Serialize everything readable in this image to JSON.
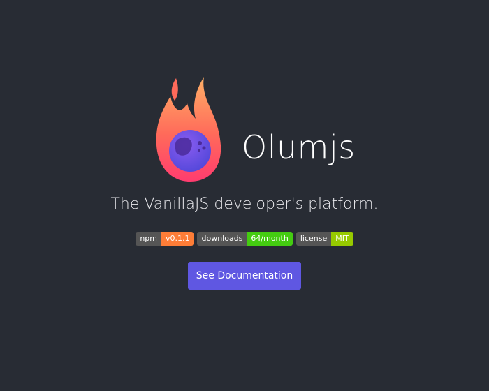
{
  "app": {
    "name": "Olumjs",
    "tagline": "The VanillaJS developer's platform."
  },
  "logo": {
    "icon": "flame-with-planet-icon",
    "flame_gradient_top": "#ff9a5a",
    "flame_gradient_bottom": "#ff3d6e",
    "planet_color": "#6b4fe0"
  },
  "badges": [
    {
      "label": "npm",
      "value": "v0.1.1",
      "color": "#fe7d37"
    },
    {
      "label": "downloads",
      "value": "64/month",
      "color": "#4c1"
    },
    {
      "label": "license",
      "value": "MIT",
      "color": "#97ca00"
    }
  ],
  "cta": {
    "label": "See Documentation",
    "color": "#5f57e2"
  }
}
